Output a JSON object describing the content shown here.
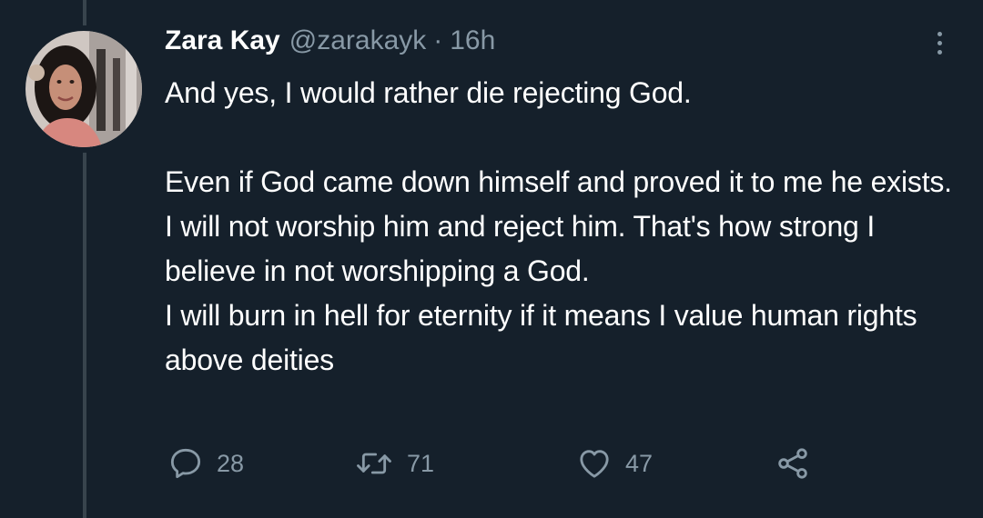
{
  "tweet": {
    "author_name": "Zara Kay",
    "author_handle": "@zarakayk",
    "separator": "·",
    "time": "16h",
    "text_lines": [
      "And yes, I would rather die rejecting God.",
      "Even if God came down himself and proved it to me he exists. I will not worship him and reject him. That's how strong I believe in not worshipping a God.",
      "I will burn in hell for eternity if it means I value human rights above deities"
    ]
  },
  "actions": {
    "reply_count": "28",
    "retweet_count": "71",
    "like_count": "47"
  },
  "icons": {
    "more": "more-vertical-icon",
    "reply": "reply-icon",
    "retweet": "retweet-icon",
    "like": "heart-icon",
    "share": "share-icon"
  },
  "colors": {
    "background": "#15202b",
    "text": "#ffffff",
    "secondary_text": "#8899a6",
    "thread_line": "#38444d"
  }
}
